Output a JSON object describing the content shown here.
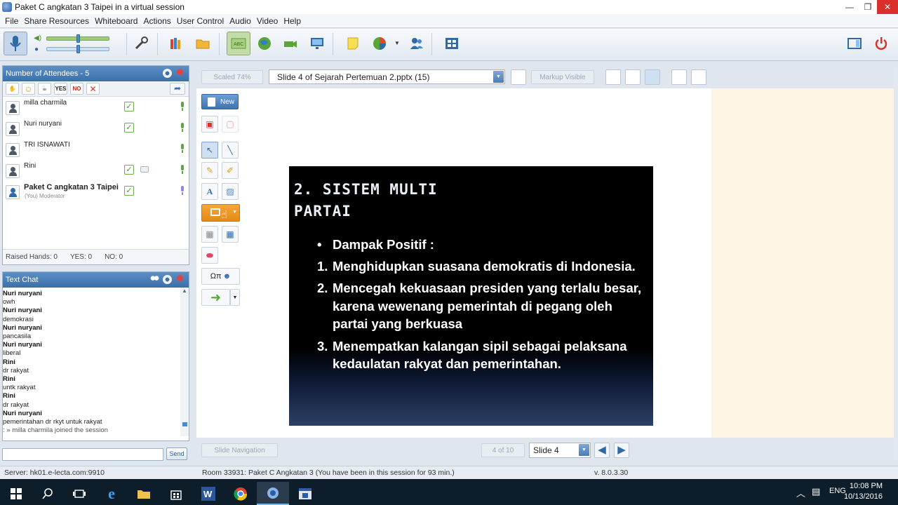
{
  "window": {
    "title": "Paket C angkatan 3 Taipei in a virtual session",
    "controls": [
      "—",
      "❐",
      "✕"
    ]
  },
  "menu": [
    "File",
    "Share Resources",
    "Whiteboard",
    "Actions",
    "User Control",
    "Audio",
    "Video",
    "Help"
  ],
  "attendees": {
    "header": "Number of Attendees - 5",
    "tools": [
      "✋",
      "☺",
      "☕",
      "YES",
      "NO",
      "✕"
    ],
    "list": [
      {
        "name": "milla charmila"
      },
      {
        "name": "Nuri nuryani"
      },
      {
        "name": "TRI ISNAWATI"
      },
      {
        "name": "Rini"
      },
      {
        "name": "Paket C angkatan 3 Taipei",
        "sub": "(You) Moderator"
      }
    ],
    "footer": {
      "raised": "Raised Hands:  0",
      "yes": "YES:  0",
      "no": "NO:  0"
    }
  },
  "chat": {
    "header": "Text Chat",
    "messages": [
      {
        "who": "Nuri nuryani",
        "text": "owh"
      },
      {
        "who": "Nuri nuryani",
        "text": "demokrasi"
      },
      {
        "who": "Nuri nuryani",
        "text": "pancasila"
      },
      {
        "who": "Nuri nuryani",
        "text": "liberal"
      },
      {
        "who": "Rini",
        "text": "dr rakyat"
      },
      {
        "who": "Rini",
        "text": "untk rakyat"
      },
      {
        "who": "Rini",
        "text": "dr rakyat"
      },
      {
        "who": "Nuri nuryani",
        "text": "pemerintahan  dr  rkyt  untuk  rakyat"
      }
    ],
    "system": ": » milla charmila joined the session",
    "input_value": "",
    "send_label": "Send"
  },
  "whiteboard": {
    "scaled": "Scaled 74%",
    "document": "Slide 4 of Sejarah Pertemuan 2.pptx (15)",
    "markup": "Markup Visible",
    "new_label": "New",
    "text_tool": "A",
    "omega_label": "Ωπ"
  },
  "slide": {
    "title_line1": "2. SISTEM MULTI",
    "title_line2": "PARTAI",
    "bullet": "Dampak Positif :",
    "items": [
      {
        "num": "1.",
        "text": "Menghidupkan suasana demokratis di Indonesia."
      },
      {
        "num": "2.",
        "text": "Mencegah kekuasaan presiden yang terlalu besar, karena wewenang pemerintah di pegang oleh partai yang berkuasa"
      },
      {
        "num": "3.",
        "text": "Menempatkan kalangan sipil sebagai pelaksana kedaulatan rakyat dan pemerintahan."
      }
    ]
  },
  "navigation": {
    "slide_nav": "Slide Navigation",
    "page": "4 of 10",
    "slide_select": "Slide 4"
  },
  "status": {
    "server": "Server: hk01.e-lecta.com:9910",
    "room": "Room 33931: Paket C Angkatan 3 (You have been in this session for 93 min.)",
    "version": "v. 8.0.3.30"
  },
  "taskbar": {
    "lang": "ENG",
    "time": "10:08 PM",
    "date": "10/13/2016"
  },
  "colors": {
    "panel_header": "#3c6ea8",
    "active_tool": "#c3dcaa",
    "shape_tool": "#f29a22",
    "slide_bg": "#000000"
  }
}
